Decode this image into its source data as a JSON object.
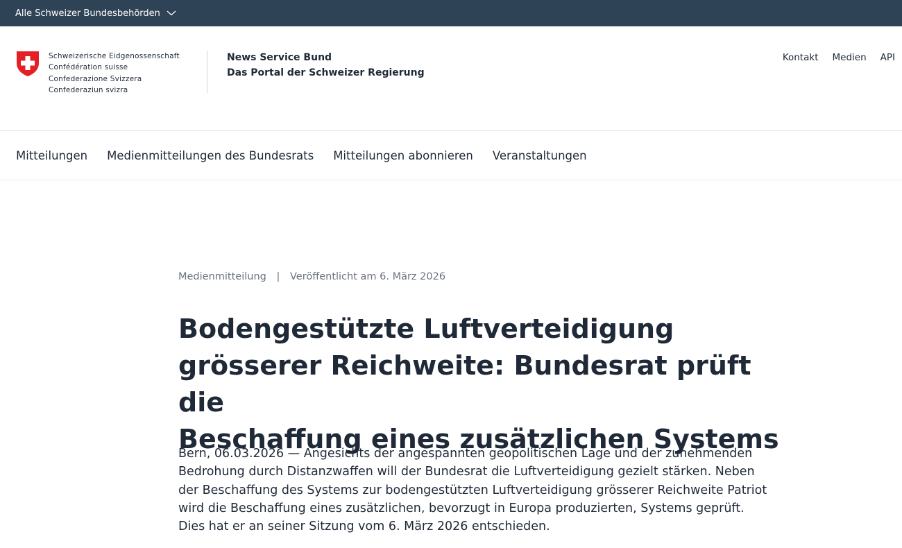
{
  "topbar": {
    "all_authorities_label": "Alle Schweizer Bundesbehörden"
  },
  "header": {
    "federation_names": [
      "Schweizerische Eidgenossenschaft",
      "Confédération suisse",
      "Confederazione Svizzera",
      "Confederaziun svizra"
    ],
    "portal_name": "News Service Bund",
    "portal_subtitle": "Das Portal der Schweizer Regierung",
    "service_nav": [
      "Kontakt",
      "Medien",
      "API"
    ]
  },
  "main_nav": [
    "Mitteilungen",
    "Medienmitteilungen des Bundesrats",
    "Mitteilungen abonnieren",
    "Veranstaltungen"
  ],
  "article": {
    "type": "Medienmitteilung",
    "separator": "|",
    "published": "Veröffentlicht am 6. März 2026",
    "title_lines": [
      "Bodengestützte Luftverteidigung",
      "grösserer Reichweite: Bundesrat prüft die",
      "Beschaffung eines zusätzlichen Systems"
    ],
    "lead_lines": [
      "Bern, 06.03.2026 — Angesichts der angespannten geopolitischen Lage und der zunehmenden",
      "Bedrohung durch Distanzwaffen will der Bundesrat die Luftverteidigung gezielt stärken. Neben",
      "der Beschaffung des Systems zur bodengestützten Luftverteidigung grösserer Reichweite Patriot",
      "wird die Beschaffung eines zusätzlichen, bevorzugt in Europa produzierten, Systems geprüft.",
      "Dies hat er an seiner Sitzung vom 6. März 2026 entschieden."
    ]
  },
  "colors": {
    "topbar_bg": "#2f4356",
    "swiss_red": "#e41f26",
    "text": "#1f2937",
    "muted": "#6b7280"
  },
  "icons": {
    "topbar_chevron": "chevron-down-icon",
    "logo": "swiss-coat-of-arms-icon"
  }
}
